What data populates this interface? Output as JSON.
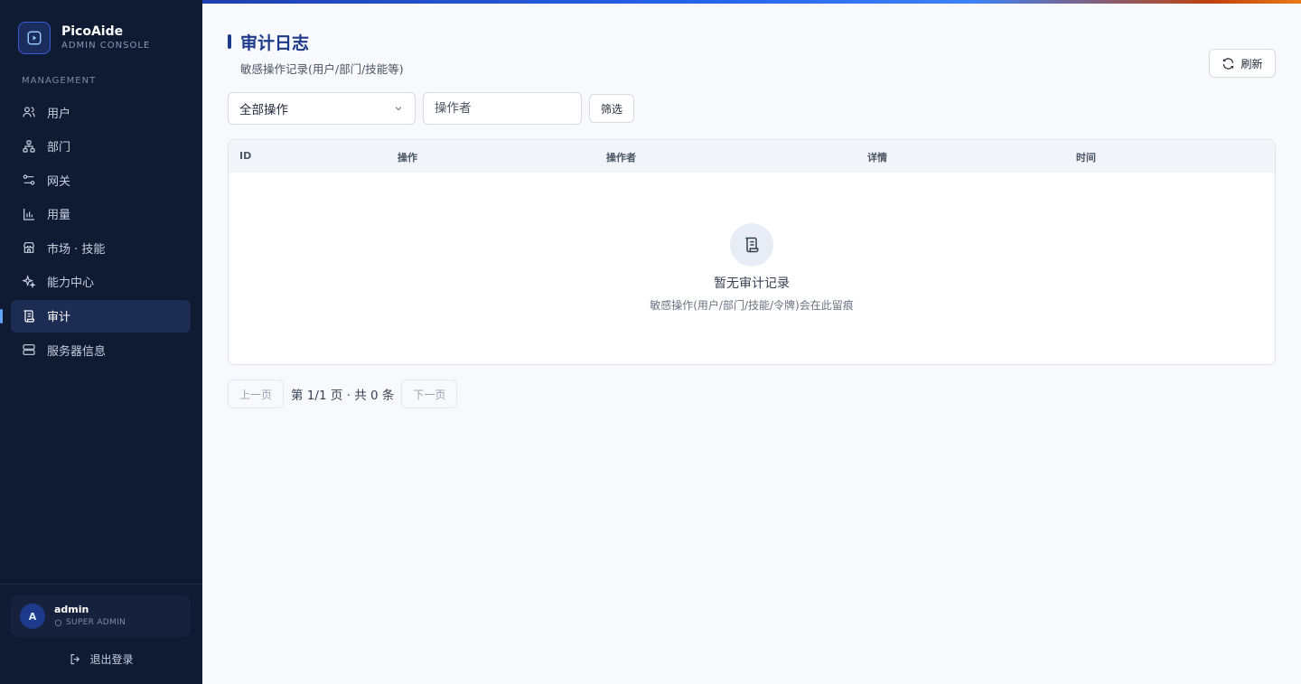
{
  "brand": {
    "name": "PicoAide",
    "subtitle": "ADMIN CONSOLE"
  },
  "sidebar": {
    "section_label": "MANAGEMENT",
    "items": [
      {
        "label": "用户",
        "icon": "users-icon"
      },
      {
        "label": "部门",
        "icon": "org-tree-icon"
      },
      {
        "label": "网关",
        "icon": "gateway-icon"
      },
      {
        "label": "用量",
        "icon": "bar-chart-icon"
      },
      {
        "label": "市场 · 技能",
        "icon": "store-icon"
      },
      {
        "label": "能力中心",
        "icon": "sparkles-icon"
      },
      {
        "label": "审计",
        "icon": "scroll-icon",
        "active": true
      },
      {
        "label": "服务器信息",
        "icon": "server-icon"
      }
    ]
  },
  "user": {
    "avatar_initial": "A",
    "name": "admin",
    "role": "SUPER ADMIN"
  },
  "logout_label": "退出登录",
  "page": {
    "title": "审计日志",
    "subtitle": "敏感操作记录(用户/部门/技能等)"
  },
  "toolbar": {
    "refresh_label": "刷新"
  },
  "filters": {
    "action_select_value": "全部操作",
    "operator_placeholder": "操作者",
    "filter_label": "筛选"
  },
  "table": {
    "columns": [
      "ID",
      "操作",
      "操作者",
      "详情",
      "时间"
    ],
    "rows": [],
    "empty_title": "暂无审计记录",
    "empty_subtitle": "敏感操作(用户/部门/技能/令牌)会在此留痕"
  },
  "pagination": {
    "prev_label": "上一页",
    "info": "第 1/1 页 · 共 0 条",
    "next_label": "下一页"
  },
  "colors": {
    "accent": "#1e3a8a",
    "sidebar_bg": "#0f1a33",
    "active_bg": "#1c2c52"
  }
}
